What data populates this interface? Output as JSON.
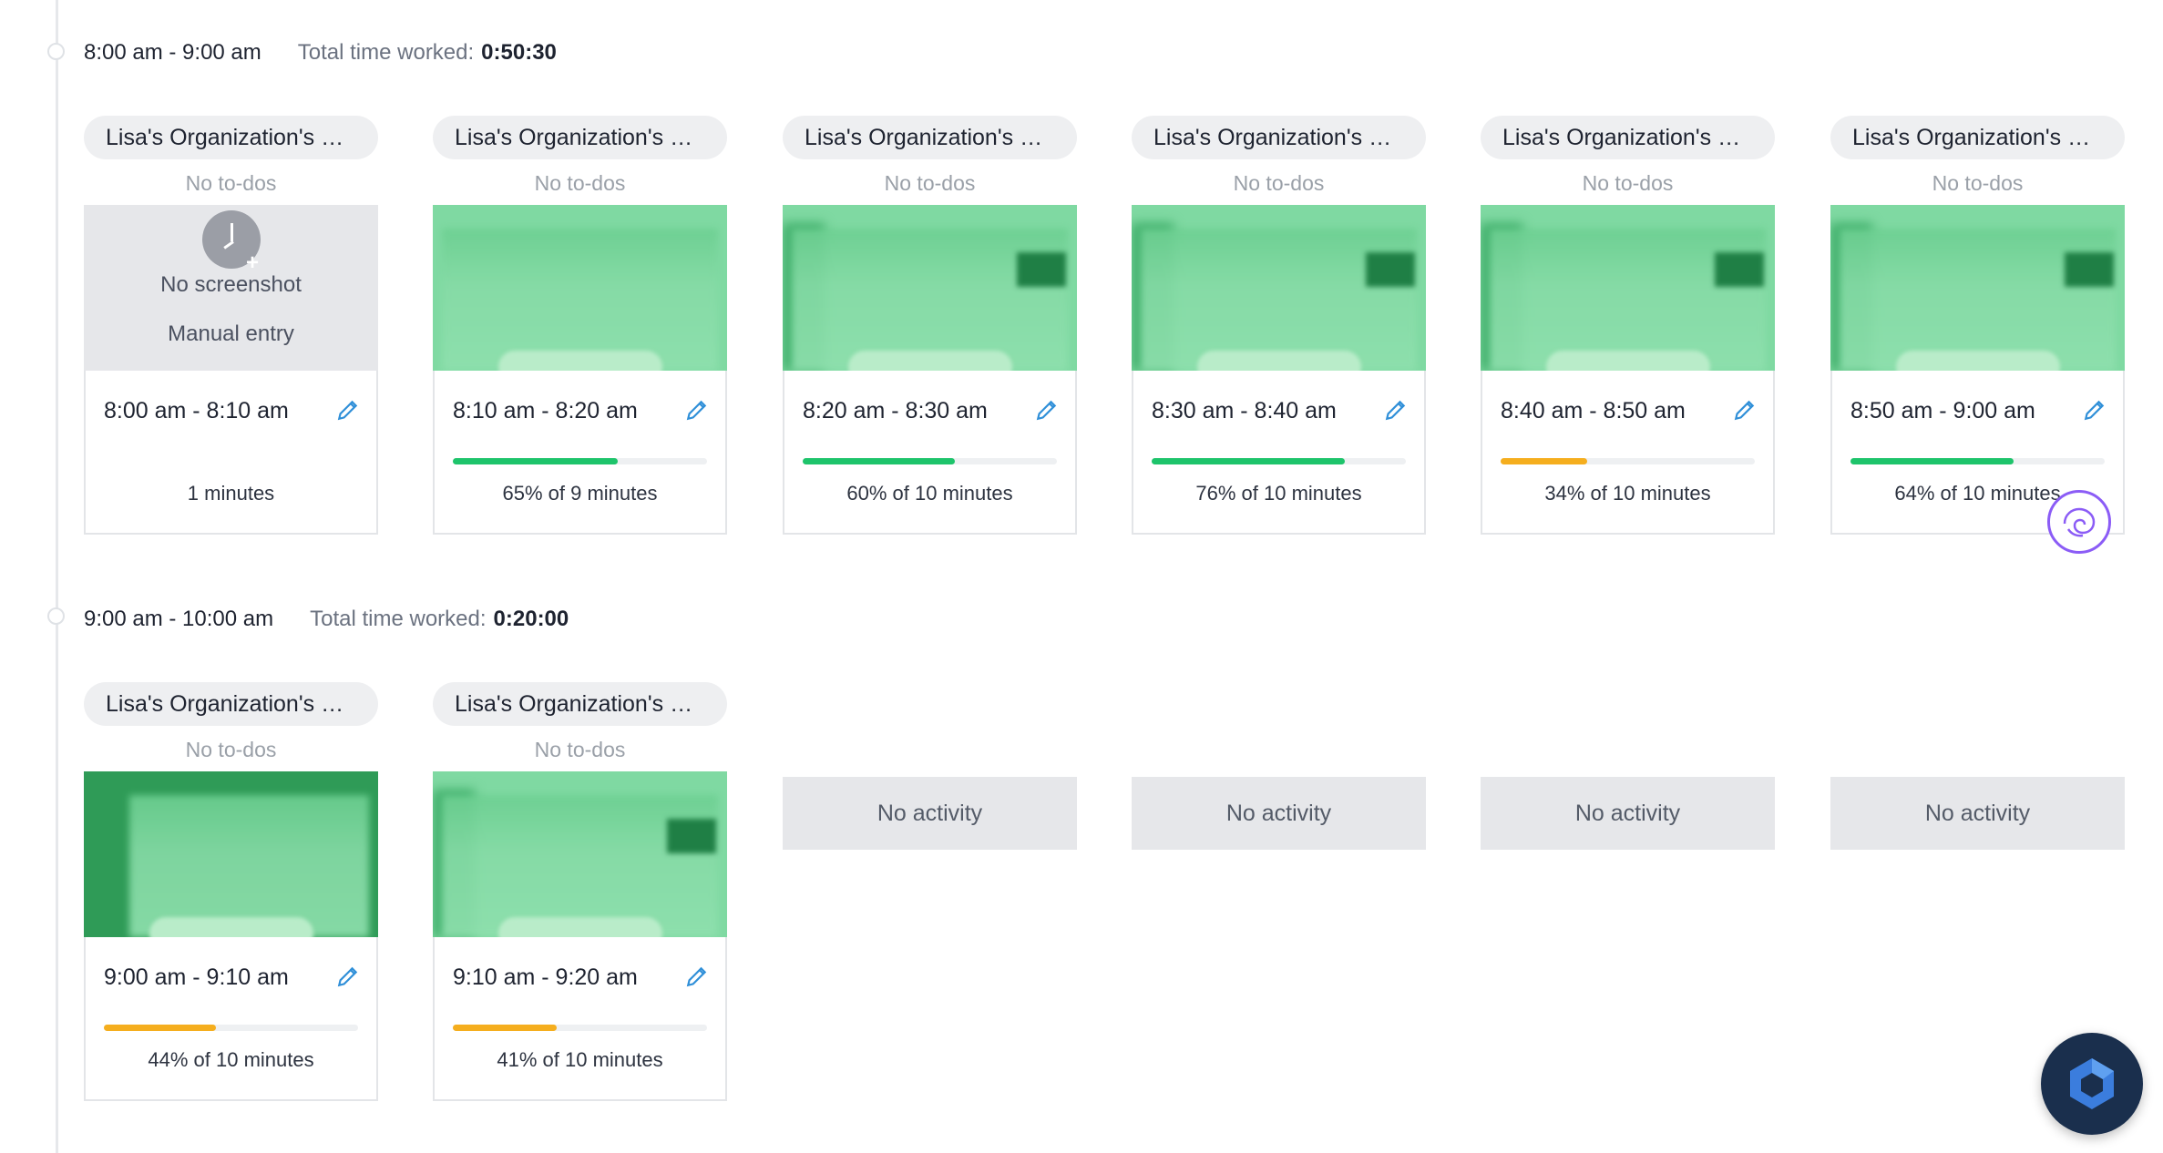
{
  "colors": {
    "green": "#1ec46b",
    "yellow": "#f5ae1e",
    "edit_blue": "#2f8fd8"
  },
  "hours": [
    {
      "range": "8:00 am - 9:00 am",
      "total_label": "Total time worked:",
      "total_value": "0:50:30",
      "slots": [
        {
          "project": "Lisa's Organization's Project",
          "todos": "No to-dos",
          "type": "manual",
          "manual_title": "No screenshot",
          "manual_subtitle": "Manual entry",
          "time": "8:00 am - 8:10 am",
          "activity": "1 minutes"
        },
        {
          "project": "Lisa's Organization's Project",
          "todos": "No to-dos",
          "type": "screenshot",
          "time": "8:10 am - 8:20 am",
          "activity": "65% of 9 minutes",
          "percent": 65,
          "bar": "green"
        },
        {
          "project": "Lisa's Organization's Project",
          "todos": "No to-dos",
          "type": "screenshot",
          "time": "8:20 am - 8:30 am",
          "activity": "60% of 10 minutes",
          "percent": 60,
          "bar": "green"
        },
        {
          "project": "Lisa's Organization's Project",
          "todos": "No to-dos",
          "type": "screenshot",
          "time": "8:30 am - 8:40 am",
          "activity": "76% of 10 minutes",
          "percent": 76,
          "bar": "green"
        },
        {
          "project": "Lisa's Organization's Project",
          "todos": "No to-dos",
          "type": "screenshot",
          "time": "8:40 am - 8:50 am",
          "activity": "34% of 10 minutes",
          "percent": 34,
          "bar": "yellow"
        },
        {
          "project": "Lisa's Organization's Project",
          "todos": "No to-dos",
          "type": "screenshot",
          "time": "8:50 am - 9:00 am",
          "activity": "64% of 10 minutes",
          "percent": 64,
          "bar": "green"
        }
      ]
    },
    {
      "range": "9:00 am - 10:00 am",
      "total_label": "Total time worked:",
      "total_value": "0:20:00",
      "slots": [
        {
          "project": "Lisa's Organization's Project",
          "todos": "No to-dos",
          "type": "screenshot",
          "time": "9:00 am - 9:10 am",
          "activity": "44% of 10 minutes",
          "percent": 44,
          "bar": "yellow"
        },
        {
          "project": "Lisa's Organization's Project",
          "todos": "No to-dos",
          "type": "screenshot",
          "time": "9:10 am - 9:20 am",
          "activity": "41% of 10 minutes",
          "percent": 41,
          "bar": "yellow"
        },
        {
          "type": "empty",
          "label": "No activity"
        },
        {
          "type": "empty",
          "label": "No activity"
        },
        {
          "type": "empty",
          "label": "No activity"
        },
        {
          "type": "empty",
          "label": "No activity"
        }
      ]
    }
  ],
  "icons": {
    "edit": "pencil-icon",
    "manual": "clock-plus-icon",
    "widget": "brain-icon",
    "launcher": "help-launcher-icon"
  }
}
